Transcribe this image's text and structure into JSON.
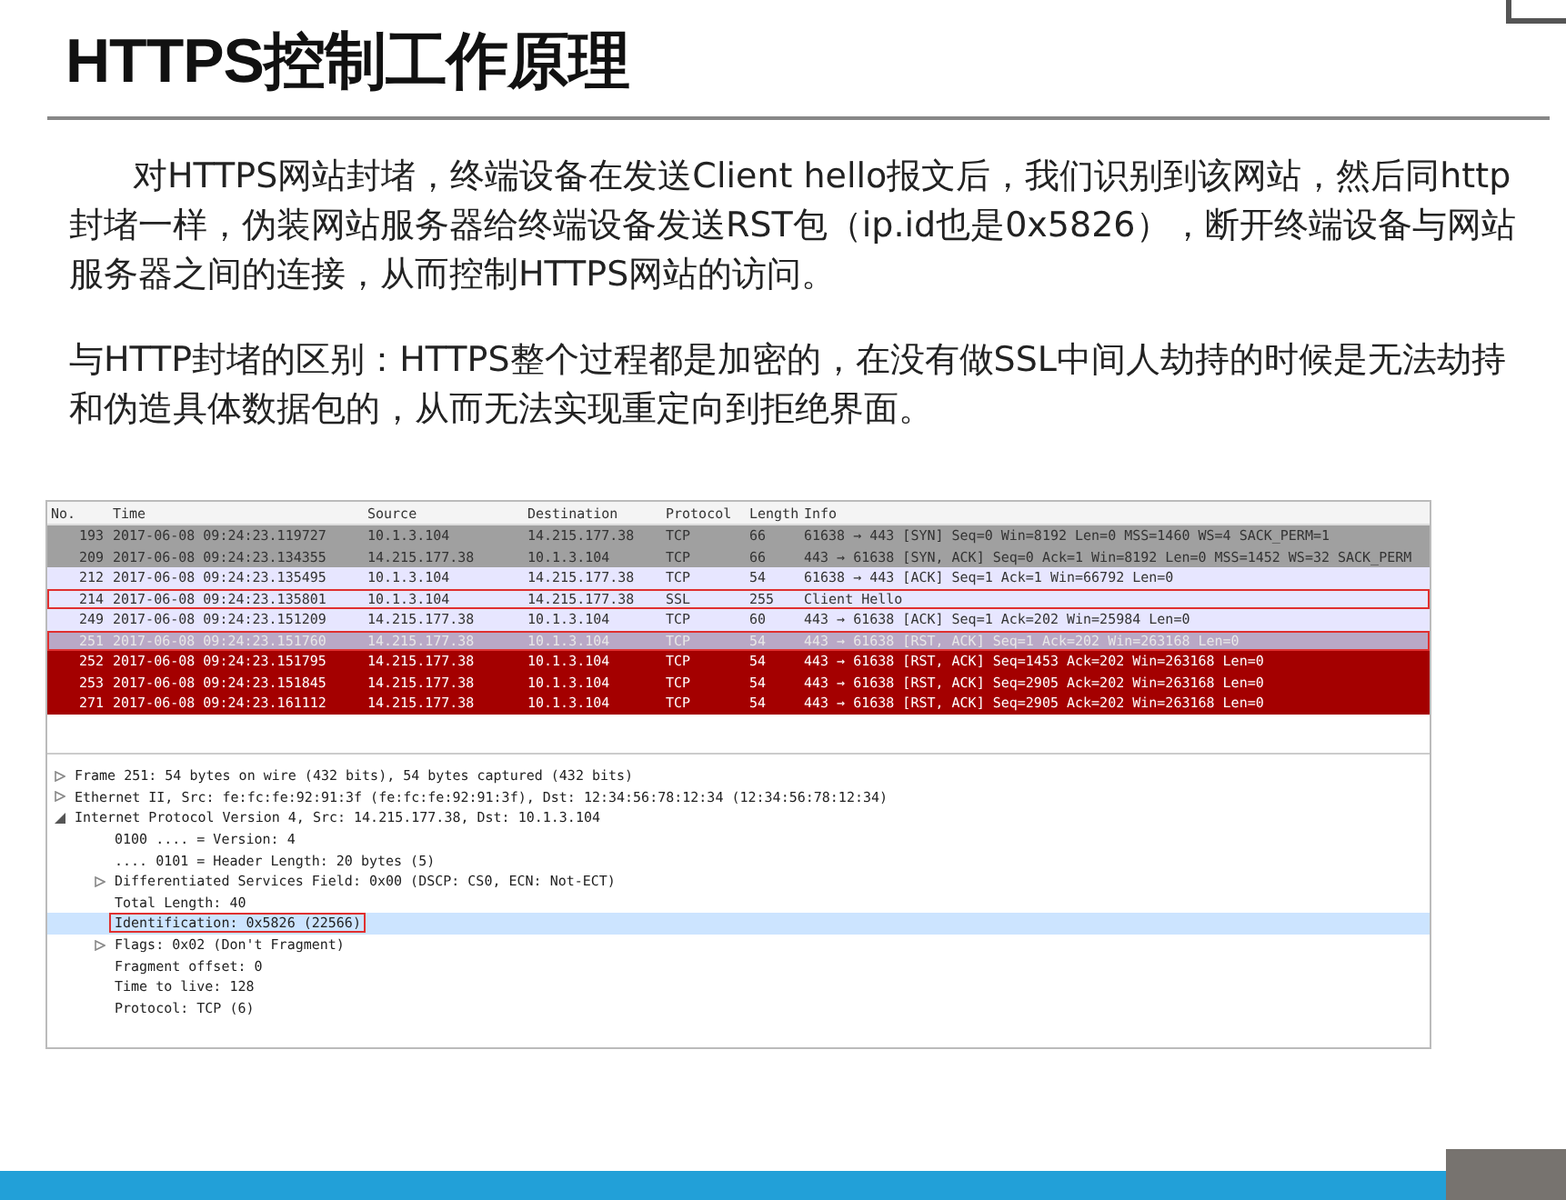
{
  "slide": {
    "title": "HTTPS控制工作原理",
    "paragraphs": [
      "对HTTPS网站封堵，终端设备在发送Client hello报文后，我们识别到该网站，然后同http封堵一样，伪装网站服务器给终端设备发送RST包（ip.id也是0x5826），断开终端设备与网站服务器之间的连接，从而控制HTTPS网站的访问。",
      "与HTTP封堵的区别：HTTPS整个过程都是加密的，在没有做SSL中间人劫持的时候是无法劫持和伪造具体数据包的，从而无法实现重定向到拒绝界面。"
    ]
  },
  "packet_list": {
    "columns": [
      "No.",
      "Time",
      "Source",
      "Destination",
      "Protocol",
      "Length",
      "Info"
    ],
    "rows": [
      {
        "no": "193",
        "time": "2017-06-08 09:24:23.119727",
        "source": "10.1.3.104",
        "destination": "14.215.177.38",
        "protocol": "TCP",
        "length": "66",
        "info": "61638 → 443 [SYN] Seq=0 Win=8192 Len=0 MSS=1460 WS=4 SACK_PERM=1",
        "color": "#a0a0a0",
        "selected": false,
        "marked": false
      },
      {
        "no": "209",
        "time": "2017-06-08 09:24:23.134355",
        "source": "14.215.177.38",
        "destination": "10.1.3.104",
        "protocol": "TCP",
        "length": "66",
        "info": "443 → 61638 [SYN, ACK] Seq=0 Ack=1 Win=8192 Len=0 MSS=1452 WS=32 SACK_PERM",
        "color": "#a0a0a0",
        "selected": false,
        "marked": false
      },
      {
        "no": "212",
        "time": "2017-06-08 09:24:23.135495",
        "source": "10.1.3.104",
        "destination": "14.215.177.38",
        "protocol": "TCP",
        "length": "54",
        "info": "61638 → 443 [ACK] Seq=1 Ack=1 Win=66792 Len=0",
        "color": "#e7e6ff",
        "selected": false,
        "marked": false
      },
      {
        "no": "214",
        "time": "2017-06-08 09:24:23.135801",
        "source": "10.1.3.104",
        "destination": "14.215.177.38",
        "protocol": "SSL",
        "length": "255",
        "info": "Client Hello",
        "color": "#e7e6ff",
        "selected": false,
        "marked": true
      },
      {
        "no": "249",
        "time": "2017-06-08 09:24:23.151209",
        "source": "14.215.177.38",
        "destination": "10.1.3.104",
        "protocol": "TCP",
        "length": "60",
        "info": "443 → 61638 [ACK] Seq=1 Ack=202 Win=25984 Len=0",
        "color": "#e7e6ff",
        "selected": false,
        "marked": false
      },
      {
        "no": "251",
        "time": "2017-06-08 09:24:23.151760",
        "source": "14.215.177.38",
        "destination": "10.1.3.104",
        "protocol": "TCP",
        "length": "54",
        "info": "443 → 61638 [RST, ACK] Seq=1 Ack=202 Win=263168 Len=0",
        "color": "#b9a8c6",
        "selected": true,
        "marked": true
      },
      {
        "no": "252",
        "time": "2017-06-08 09:24:23.151795",
        "source": "14.215.177.38",
        "destination": "10.1.3.104",
        "protocol": "TCP",
        "length": "54",
        "info": "443 → 61638 [RST, ACK] Seq=1453 Ack=202 Win=263168 Len=0",
        "color": "#a40000",
        "selected": false,
        "marked": false
      },
      {
        "no": "253",
        "time": "2017-06-08 09:24:23.151845",
        "source": "14.215.177.38",
        "destination": "10.1.3.104",
        "protocol": "TCP",
        "length": "54",
        "info": "443 → 61638 [RST, ACK] Seq=2905 Ack=202 Win=263168 Len=0",
        "color": "#a40000",
        "selected": false,
        "marked": false
      },
      {
        "no": "271",
        "time": "2017-06-08 09:24:23.161112",
        "source": "14.215.177.38",
        "destination": "10.1.3.104",
        "protocol": "TCP",
        "length": "54",
        "info": "443 → 61638 [RST, ACK] Seq=2905 Ack=202 Win=263168 Len=0",
        "color": "#a40000",
        "selected": false,
        "marked": false
      }
    ]
  },
  "packet_details": [
    {
      "text": "Frame 251: 54 bytes on wire (432 bits), 54 bytes captured (432 bits)",
      "expanded": false,
      "selected": false,
      "marked": false
    },
    {
      "text": "Ethernet II, Src: fe:fc:fe:92:91:3f (fe:fc:fe:92:91:3f), Dst: 12:34:56:78:12:34 (12:34:56:78:12:34)",
      "expanded": false,
      "selected": false,
      "marked": false
    },
    {
      "text": "Internet Protocol Version 4, Src: 14.215.177.38, Dst: 10.1.3.104",
      "expanded": true,
      "selected": false,
      "marked": false,
      "children": [
        {
          "text": "0100 .... = Version: 4",
          "selected": false,
          "marked": false
        },
        {
          "text": ".... 0101 = Header Length: 20 bytes (5)",
          "selected": false,
          "marked": false
        },
        {
          "text": "Differentiated Services Field: 0x00 (DSCP: CS0, ECN: Not-ECT)",
          "expanded": false,
          "selected": false,
          "marked": false
        },
        {
          "text": "Total Length: 40",
          "selected": false,
          "marked": false
        },
        {
          "text": "Identification: 0x5826 (22566)",
          "selected": true,
          "marked": true
        },
        {
          "text": "Flags: 0x02 (Don't Fragment)",
          "expanded": false,
          "selected": false,
          "marked": false
        },
        {
          "text": "Fragment offset: 0",
          "selected": false,
          "marked": false
        },
        {
          "text": "Time to live: 128",
          "selected": false,
          "marked": false
        },
        {
          "text": "Protocol: TCP (6)",
          "selected": false,
          "marked": false
        }
      ]
    }
  ]
}
